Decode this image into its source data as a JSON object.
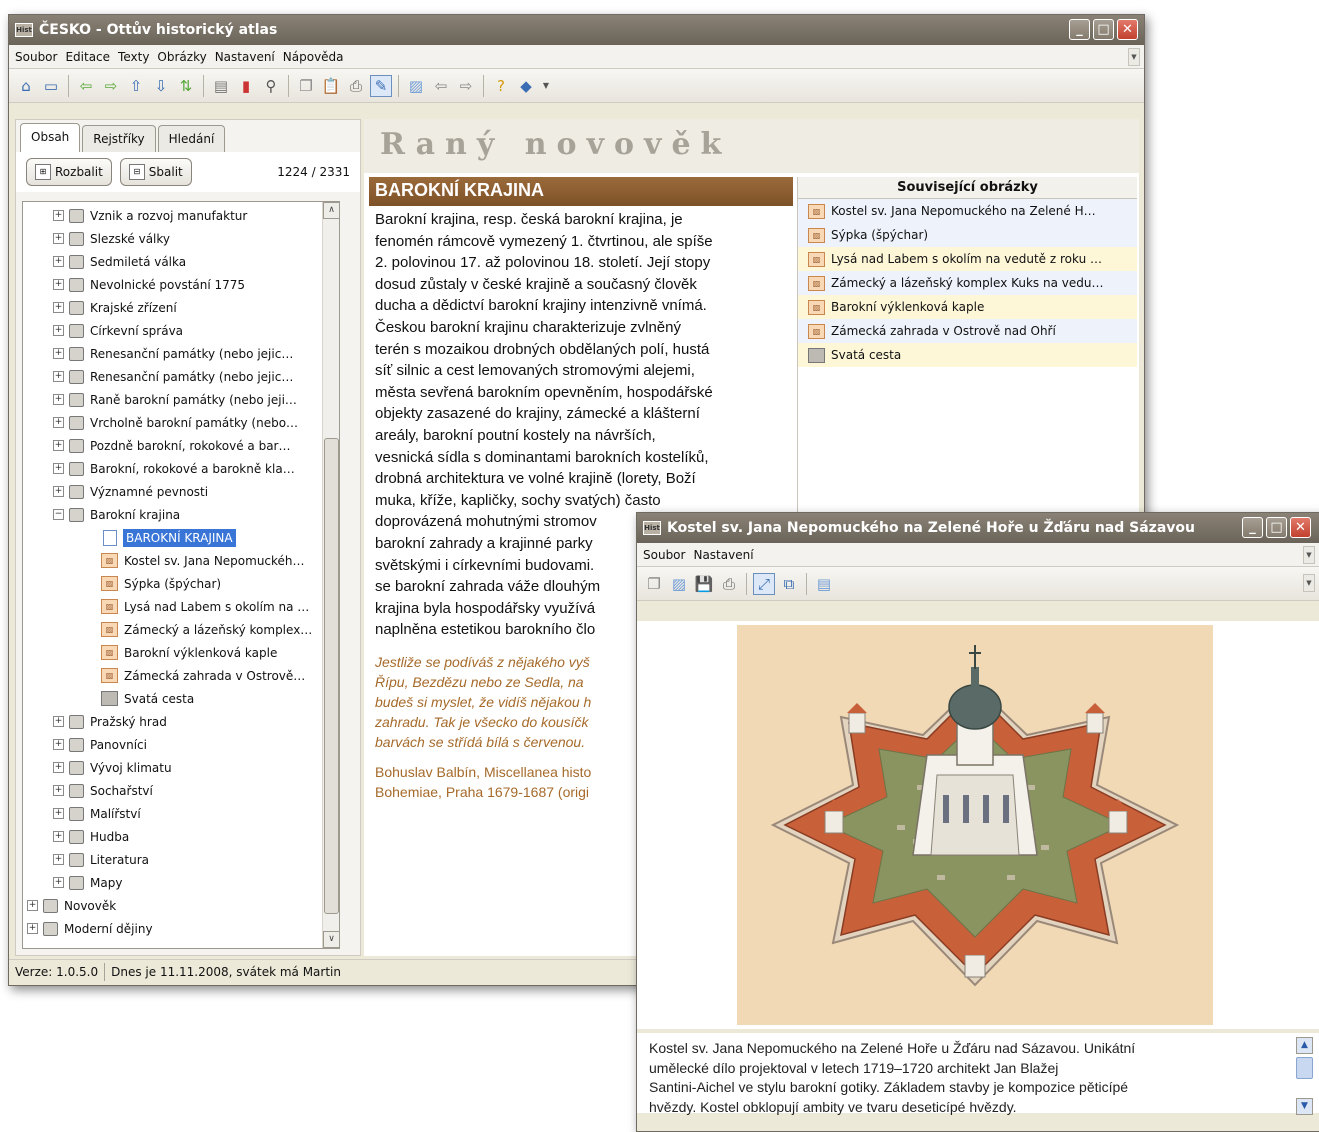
{
  "main": {
    "title": "ČESKO - Ottův historický atlas",
    "app_icon_text": "Hist",
    "menu": [
      "Soubor",
      "Editace",
      "Texty",
      "Obrázky",
      "Nastavení",
      "Nápověda"
    ],
    "tabs": [
      "Obsah",
      "Rejstříky",
      "Hledání"
    ],
    "expand_button": "Rozbalit",
    "collapse_button": "Sbalit",
    "count": "1224 / 2331",
    "tree": [
      {
        "label": "Vznik a rozvoj manufaktur",
        "type": "folder",
        "level": 1,
        "sign": "+"
      },
      {
        "label": "Slezské války",
        "type": "folder",
        "level": 1,
        "sign": "+"
      },
      {
        "label": "Sedmiletá válka",
        "type": "folder",
        "level": 1,
        "sign": "+"
      },
      {
        "label": "Nevolnické povstání 1775",
        "type": "folder",
        "level": 1,
        "sign": "+"
      },
      {
        "label": "Krajské zřízení",
        "type": "folder",
        "level": 1,
        "sign": "+"
      },
      {
        "label": "Církevní správa",
        "type": "folder",
        "level": 1,
        "sign": "+"
      },
      {
        "label": "Renesanční památky (nebo jejic…",
        "type": "folder",
        "level": 1,
        "sign": "+"
      },
      {
        "label": "Renesanční památky (nebo jejic…",
        "type": "folder",
        "level": 1,
        "sign": "+"
      },
      {
        "label": "Raně barokní památky (nebo jeji…",
        "type": "folder",
        "level": 1,
        "sign": "+"
      },
      {
        "label": "Vrcholně barokní památky (nebo…",
        "type": "folder",
        "level": 1,
        "sign": "+"
      },
      {
        "label": "Pozdně barokní, rokokové a bar…",
        "type": "folder",
        "level": 1,
        "sign": "+"
      },
      {
        "label": "Barokní, rokokové a barokně kla…",
        "type": "folder",
        "level": 1,
        "sign": "+"
      },
      {
        "label": "Významné pevnosti",
        "type": "folder",
        "level": 1,
        "sign": "+"
      },
      {
        "label": "Barokní krajina",
        "type": "folder",
        "level": 1,
        "sign": "−"
      },
      {
        "label": "BAROKNÍ KRAJINA",
        "type": "doc",
        "level": 2,
        "selected": true
      },
      {
        "label": "Kostel sv. Jana Nepomuckéh…",
        "type": "pic",
        "level": 2
      },
      {
        "label": "Sýpka (špýchar)",
        "type": "pic",
        "level": 2
      },
      {
        "label": "Lysá nad Labem s okolím na …",
        "type": "pic",
        "level": 2
      },
      {
        "label": "Zámecký a lázeňský komplex…",
        "type": "pic",
        "level": 2
      },
      {
        "label": "Barokní výklenková kaple",
        "type": "pic",
        "level": 2
      },
      {
        "label": "Zámecká zahrada v Ostrově…",
        "type": "pic",
        "level": 2
      },
      {
        "label": "Svatá cesta",
        "type": "gray",
        "level": 2
      },
      {
        "label": "Pražský hrad",
        "type": "folder",
        "level": 1,
        "sign": "+"
      },
      {
        "label": "Panovníci",
        "type": "folder",
        "level": 1,
        "sign": "+"
      },
      {
        "label": "Vývoj klimatu",
        "type": "folder",
        "level": 1,
        "sign": "+"
      },
      {
        "label": "Sochařství",
        "type": "folder",
        "level": 1,
        "sign": "+"
      },
      {
        "label": "Malířství",
        "type": "folder",
        "level": 1,
        "sign": "+"
      },
      {
        "label": "Hudba",
        "type": "folder",
        "level": 1,
        "sign": "+"
      },
      {
        "label": "Literatura",
        "type": "folder",
        "level": 1,
        "sign": "+"
      },
      {
        "label": "Mapy",
        "type": "folder",
        "level": 1,
        "sign": "+"
      },
      {
        "label": "Novověk",
        "type": "folder",
        "level": 0,
        "sign": "+"
      },
      {
        "label": "Moderní dějiny",
        "type": "folder",
        "level": 0,
        "sign": "+"
      }
    ],
    "section_title": "Raný novověk",
    "article_title": "BAROKNÍ KRAJINA",
    "article_lines": [
      "Barokní krajina, resp. česká barokní krajina, je",
      "fenomén rámcově vymezený 1. čtvrtinou, ale spíše",
      "2. polovinou 17. až polovinou 18. století. Její stopy",
      "dosud zůstaly v české krajině a současný člověk",
      "ducha a dědictví barokní krajiny intenzivně vnímá.",
      "Českou barokní krajinu charakterizuje zvlněný",
      "terén s mozaikou drobných obdělaných polí, hustá",
      "síť silnic a cest lemovaných stromovými alejemi,",
      "města sevřená barokním opevněním, hospodářské",
      "objekty zasazené do krajiny, zámecké a klášterní",
      "areály, barokní poutní kostely na návrších,",
      "vesnická sídla s dominantami barokních kostelíků,",
      "drobná architektura ve volné krajině (lorety, Boží",
      "muka, kříže, kapličky, sochy svatých) často",
      "doprovázená mohutnými stromov",
      "barokní zahrady a krajinné parky",
      "světskými i církevními budovami.",
      "se barokní zahrada váže dlouhým",
      "krajina byla hospodářsky využívá",
      "naplněna estetikou barokního člo"
    ],
    "quote_lines": [
      "Jestliže se podíváš z nějakého vyš",
      "Řípu, Bezdězu nebo ze Sedla, na",
      "budeš si myslet, že vidíš nějakou h",
      "zahradu. Tak je všecko do kousíčk",
      "barvách se střídá bílá s červenou."
    ],
    "author_lines": [
      "Bohuslav Balbín, Miscellanea histo",
      "Bohemiae, Praha 1679-1687 (origi"
    ],
    "related_title": "Související obrázky",
    "related": [
      "Kostel sv. Jana Nepomuckého na Zelené H…",
      "Sýpka (špýchar)",
      "Lysá nad Labem s okolím na vedutě z roku …",
      "Zámecký a lázeňský komplex Kuks na vedu…",
      "Barokní výklenková kaple",
      "Zámecká zahrada v Ostrově nad Ohří",
      "Svatá cesta"
    ],
    "status_version": "Verze: 1.0.5.0",
    "status_date": "Dnes je 11.11.2008, svátek má Martin"
  },
  "viewer": {
    "title": "Kostel sv. Jana Nepomuckého na Zelené Hoře u Žďáru nad Sázavou",
    "app_icon_text": "Hist",
    "menu": [
      "Soubor",
      "Nastavení"
    ],
    "caption_lines": [
      "Kostel sv. Jana Nepomuckého na Zelené Hoře u Žďáru nad Sázavou. Unikátní",
      "umělecké dílo projektoval v letech 1719–1720 architekt Jan Blažej",
      "Santini-Aichel ve stylu barokní gotiky. Základem stavby je kompozice pěticípé",
      "hvězdy. Kostel obklopují ambity ve tvaru deseticípé hvězdy."
    ]
  },
  "colors": {
    "titlebar": "#7a7266",
    "article_header": "#8a5c30",
    "quote": "#a66a2a",
    "selection": "#3875d7",
    "image_bg": "#f1d9b6"
  }
}
